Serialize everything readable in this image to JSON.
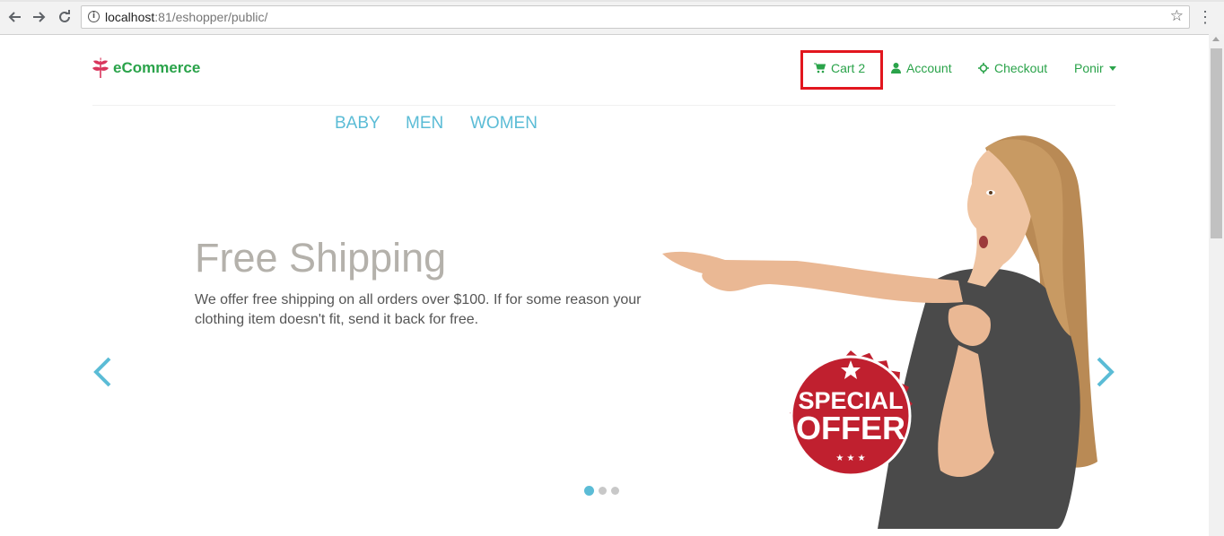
{
  "browser": {
    "url_host": "localhost",
    "url_rest": ":81/eshopper/public/",
    "back_icon": "arrow-left-icon",
    "forward_icon": "arrow-right-icon",
    "reload_icon": "reload-icon",
    "bookmark_icon": "star-icon",
    "menu_icon": "kebab-menu-icon"
  },
  "header": {
    "brand": "eCommerce",
    "nav": {
      "cart": "Cart 2",
      "account": "Account",
      "checkout": "Checkout",
      "user": "Ponir"
    }
  },
  "categories": [
    "BABY",
    "MEN",
    "WOMEN"
  ],
  "hero": {
    "title": "Free Shipping",
    "text": "We offer free shipping on all orders over $100. If for some reason your clothing item doesn't fit, send it back for free.",
    "badge_line1": "SPECIAL",
    "badge_line2": "OFFER",
    "slides": 3,
    "active_slide": 1
  },
  "colors": {
    "brand_green": "#2aa34a",
    "accent_blue": "#5bbcd6",
    "highlight_red": "#e2161e",
    "badge_red": "#c0202f"
  }
}
